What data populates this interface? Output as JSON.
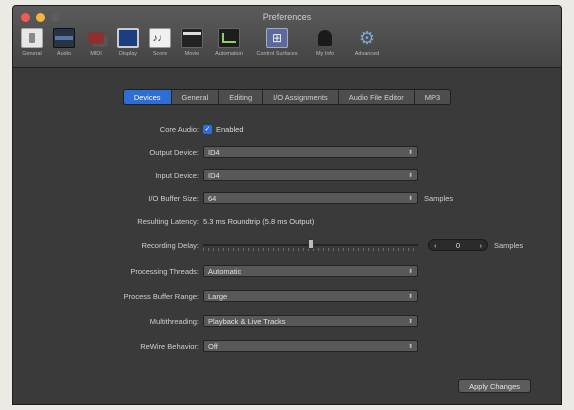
{
  "window": {
    "title": "Preferences"
  },
  "toolbar": [
    {
      "label": "General",
      "icon": "general-icon"
    },
    {
      "label": "Audio",
      "icon": "audio-icon"
    },
    {
      "label": "MIDI",
      "icon": "midi-icon"
    },
    {
      "label": "Display",
      "icon": "display-icon"
    },
    {
      "label": "Score",
      "icon": "score-icon"
    },
    {
      "label": "Movie",
      "icon": "movie-icon"
    },
    {
      "label": "Automation",
      "icon": "automation-icon"
    },
    {
      "label": "Control Surfaces",
      "icon": "control-surfaces-icon"
    },
    {
      "label": "My Info",
      "icon": "my-info-icon"
    },
    {
      "label": "Advanced",
      "icon": "advanced-icon"
    }
  ],
  "tabs": [
    {
      "label": "Devices",
      "active": true
    },
    {
      "label": "General",
      "active": false
    },
    {
      "label": "Editing",
      "active": false
    },
    {
      "label": "I/O Assignments",
      "active": false
    },
    {
      "label": "Audio File Editor",
      "active": false
    },
    {
      "label": "MP3",
      "active": false
    }
  ],
  "settings": {
    "core_audio": {
      "label": "Core Audio:",
      "checkbox_label": "Enabled",
      "checked": true
    },
    "output_device": {
      "label": "Output Device:",
      "value": "ID4"
    },
    "input_device": {
      "label": "Input Device:",
      "value": "ID4"
    },
    "buffer_size": {
      "label": "I/O Buffer Size:",
      "value": "64",
      "suffix": "Samples"
    },
    "latency": {
      "label": "Resulting Latency:",
      "value": "5.3 ms Roundtrip (5.8 ms Output)"
    },
    "recording_delay": {
      "label": "Recording Delay:",
      "value": "0",
      "suffix": "Samples",
      "slider_fraction": 0.5
    },
    "processing_threads": {
      "label": "Processing Threads:",
      "value": "Automatic"
    },
    "process_buffer_range": {
      "label": "Process Buffer Range:",
      "value": "Large"
    },
    "multithreading": {
      "label": "Multithreading:",
      "value": "Playback & Live Tracks"
    },
    "rewire_behavior": {
      "label": "ReWire Behavior:",
      "value": "Off"
    }
  },
  "apply_button": "Apply Changes",
  "colors": {
    "accent": "#2c6ed4",
    "panel": "#3a3a3a"
  }
}
